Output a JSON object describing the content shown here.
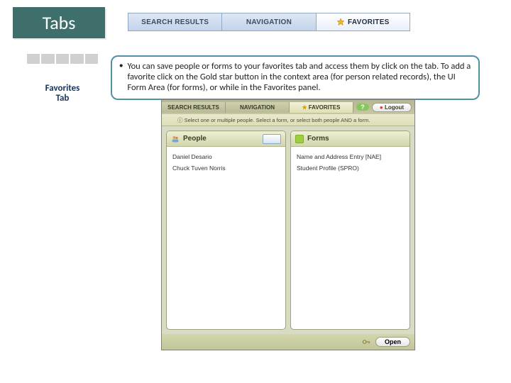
{
  "title_badge": "Tabs",
  "top_tabs": {
    "search": "SEARCH RESULTS",
    "navigation": "NAVIGATION",
    "favorites": "FAVORITES"
  },
  "side_label": {
    "line1": "Favorites",
    "line2": "Tab"
  },
  "bullet_text": "You can save people or forms to your favorites tab and access them by click on the tab. To add a favorite click on the Gold star button in the context area (for person related records), the UI Form Area (for forms), or while in the Favorites panel.",
  "embed": {
    "tabs": {
      "search": "SEARCH RESULTS",
      "navigation": "NAVIGATION",
      "favorites": "FAVORITES"
    },
    "help": "?",
    "logout": "Logout",
    "hint": "Select one or multiple people. Select a form, or select both people AND a form.",
    "people": {
      "header": "People",
      "rows": [
        "Daniel Desario",
        "Chuck Tuven Norris"
      ]
    },
    "forms": {
      "header": "Forms",
      "rows": [
        "Name and Address Entry [NAE]",
        "Student Profile (SPRO)"
      ]
    },
    "open": "Open"
  }
}
